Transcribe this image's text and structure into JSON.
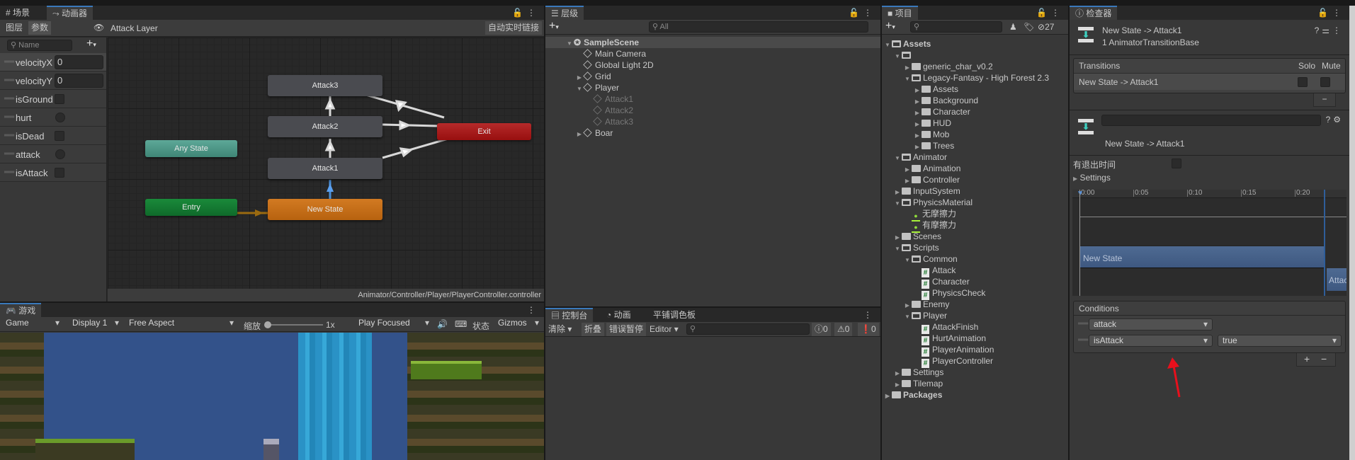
{
  "animator": {
    "tabs": [
      {
        "label": "场景",
        "icon": "grid-icon"
      },
      {
        "label": "动画器",
        "icon": "animator-icon"
      }
    ],
    "layers_tab": "图层",
    "params_tab": "参数",
    "breadcrumb": "Attack Layer",
    "live_link": "自动实时链接",
    "name_placeholder": "Name",
    "parameters": [
      {
        "name": "velocityX",
        "type": "float",
        "value": "0"
      },
      {
        "name": "velocityY",
        "type": "float",
        "value": "0"
      },
      {
        "name": "isGround",
        "type": "bool"
      },
      {
        "name": "hurt",
        "type": "trigger"
      },
      {
        "name": "isDead",
        "type": "bool"
      },
      {
        "name": "attack",
        "type": "trigger"
      },
      {
        "name": "isAttack",
        "type": "bool"
      }
    ],
    "nodes": {
      "attack3": "Attack3",
      "attack2": "Attack2",
      "attack1": "Attack1",
      "new_state": "New State",
      "exit": "Exit",
      "any_state": "Any State",
      "entry": "Entry"
    },
    "node_colors": {
      "state": "#4a4b50",
      "default": "#c9711b",
      "exit": "#a91c1c",
      "any": "#4f9a8a",
      "entry": "#167a32"
    },
    "path": "Animator/Controller/Player/PlayerController.controller"
  },
  "game": {
    "tab": "游戏",
    "view": "Game",
    "display": "Display 1",
    "aspect": "Free Aspect",
    "scale_label": "缩放",
    "scale_value": "1x",
    "play_mode": "Play Focused",
    "stats": "状态",
    "gizmos": "Gizmos"
  },
  "hierarchy": {
    "tab": "层级",
    "search_placeholder": "All",
    "items": [
      {
        "label": "SampleScene",
        "depth": 0,
        "arrow": "open",
        "kind": "scene"
      },
      {
        "label": "Main Camera",
        "depth": 1,
        "arrow": "none",
        "kind": "go"
      },
      {
        "label": "Global Light 2D",
        "depth": 1,
        "arrow": "none",
        "kind": "go"
      },
      {
        "label": "Grid",
        "depth": 1,
        "arrow": "closed",
        "kind": "go"
      },
      {
        "label": "Player",
        "depth": 1,
        "arrow": "open",
        "kind": "go"
      },
      {
        "label": "Attack1",
        "depth": 2,
        "arrow": "none",
        "kind": "inactive"
      },
      {
        "label": "Attack2",
        "depth": 2,
        "arrow": "none",
        "kind": "inactive"
      },
      {
        "label": "Attack3",
        "depth": 2,
        "arrow": "none",
        "kind": "inactive"
      },
      {
        "label": "Boar",
        "depth": 1,
        "arrow": "closed",
        "kind": "go"
      }
    ]
  },
  "console": {
    "tabs": [
      "控制台",
      "动画",
      "平铺调色板"
    ],
    "clear": "清除",
    "collapse": "折叠",
    "error_pause": "错误暂停",
    "editor": "Editor",
    "info_count": "0",
    "warning_count": "0",
    "error_count": "0"
  },
  "project": {
    "tab": "项目",
    "hidden_count": "27",
    "items": [
      {
        "label": "Assets",
        "depth": 0,
        "arrow": "open",
        "kind": "folder-open",
        "bold": true
      },
      {
        "label": "",
        "depth": 1,
        "arrow": "open",
        "kind": "folder-open"
      },
      {
        "label": "generic_char_v0.2",
        "depth": 2,
        "arrow": "closed",
        "kind": "folder"
      },
      {
        "label": "Legacy-Fantasy - High Forest 2.3",
        "depth": 2,
        "arrow": "open",
        "kind": "folder-open"
      },
      {
        "label": "Assets",
        "depth": 3,
        "arrow": "closed",
        "kind": "folder"
      },
      {
        "label": "Background",
        "depth": 3,
        "arrow": "closed",
        "kind": "folder"
      },
      {
        "label": "Character",
        "depth": 3,
        "arrow": "closed",
        "kind": "folder"
      },
      {
        "label": "HUD",
        "depth": 3,
        "arrow": "closed",
        "kind": "folder"
      },
      {
        "label": "Mob",
        "depth": 3,
        "arrow": "closed",
        "kind": "folder"
      },
      {
        "label": "Trees",
        "depth": 3,
        "arrow": "closed",
        "kind": "folder"
      },
      {
        "label": "Animator",
        "depth": 1,
        "arrow": "open",
        "kind": "folder-open"
      },
      {
        "label": "Animation",
        "depth": 2,
        "arrow": "closed",
        "kind": "folder"
      },
      {
        "label": "Controller",
        "depth": 2,
        "arrow": "closed",
        "kind": "folder"
      },
      {
        "label": "InputSystem",
        "depth": 1,
        "arrow": "closed",
        "kind": "folder"
      },
      {
        "label": "PhysicsMaterial",
        "depth": 1,
        "arrow": "open",
        "kind": "folder-open"
      },
      {
        "label": "无摩擦力",
        "depth": 2,
        "arrow": "none",
        "kind": "physics-material"
      },
      {
        "label": "有摩擦力",
        "depth": 2,
        "arrow": "none",
        "kind": "physics-material"
      },
      {
        "label": "Scenes",
        "depth": 1,
        "arrow": "closed",
        "kind": "folder"
      },
      {
        "label": "Scripts",
        "depth": 1,
        "arrow": "open",
        "kind": "folder-open"
      },
      {
        "label": "Common",
        "depth": 2,
        "arrow": "open",
        "kind": "folder-open"
      },
      {
        "label": "Attack",
        "depth": 3,
        "arrow": "none",
        "kind": "script"
      },
      {
        "label": "Character",
        "depth": 3,
        "arrow": "none",
        "kind": "script"
      },
      {
        "label": "PhysicsCheck",
        "depth": 3,
        "arrow": "none",
        "kind": "script"
      },
      {
        "label": "Enemy",
        "depth": 2,
        "arrow": "closed",
        "kind": "folder"
      },
      {
        "label": "Player",
        "depth": 2,
        "arrow": "open",
        "kind": "folder-open"
      },
      {
        "label": "AttackFinish",
        "depth": 3,
        "arrow": "none",
        "kind": "script"
      },
      {
        "label": "HurtAnimation",
        "depth": 3,
        "arrow": "none",
        "kind": "script"
      },
      {
        "label": "PlayerAnimation",
        "depth": 3,
        "arrow": "none",
        "kind": "script"
      },
      {
        "label": "PlayerController",
        "depth": 3,
        "arrow": "none",
        "kind": "script"
      },
      {
        "label": "Settings",
        "depth": 1,
        "arrow": "closed",
        "kind": "folder"
      },
      {
        "label": "Tilemap",
        "depth": 1,
        "arrow": "closed",
        "kind": "folder"
      },
      {
        "label": "Packages",
        "depth": 0,
        "arrow": "closed",
        "kind": "folder",
        "bold": true
      }
    ]
  },
  "inspector": {
    "tab": "检查器",
    "title": "New State -> Attack1",
    "subtitle": "1 AnimatorTransitionBase",
    "transitions_header": "Transitions",
    "solo": "Solo",
    "mute": "Mute",
    "transition_row": "New State -> Attack1",
    "name_value": "",
    "transition_label": "New State -> Attack1",
    "has_exit_time": "有退出时间",
    "has_exit_time_checked": false,
    "settings": "Settings",
    "ruler": [
      "0:00",
      "0:05",
      "0:10",
      "0:15",
      "0:20"
    ],
    "source_clip": "New State",
    "dest_clip": "Attac",
    "conditions_header": "Conditions",
    "conditions": [
      {
        "parameter": "attack"
      },
      {
        "parameter": "isAttack",
        "value": "true"
      }
    ],
    "accent": "#3a79bb"
  }
}
